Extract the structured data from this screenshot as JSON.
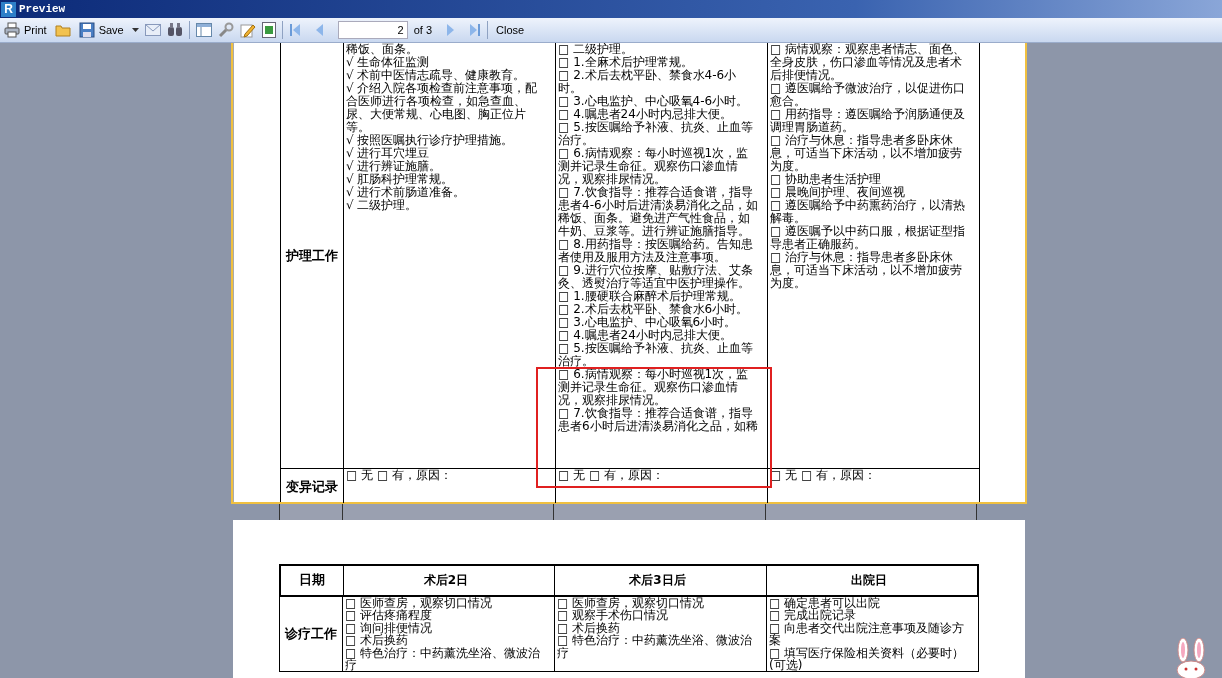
{
  "window": {
    "logo": "R",
    "title": "Preview"
  },
  "toolbar": {
    "print": "Print",
    "save": "Save",
    "page": "2",
    "of": "of 3",
    "close": "Close"
  },
  "pages": [
    {
      "selected": true,
      "highlight": true,
      "rows": [
        {
          "label": "护理工作",
          "cells": [
            [
              "稀饭、面条。",
              "√ 生命体征监测",
              "√ 术前中医情志疏导、健康教育。",
              "√ 介绍入院各项检查前注意事项，配合医师进行各项检查，如急查血、尿、大便常规、心电图、胸正位片等。",
              "√ 按照医嘱执行诊疗护理措施。",
              "√ 进行耳穴埋豆",
              "√ 进行辨证施膳。",
              "√ 肛肠科护理常规。",
              "√ 进行术前肠道准备。",
              "√ 二级护理。"
            ],
            [
              "□ 二级护理。",
              "□ 1.全麻术后护理常规。",
              "□ 2.术后去枕平卧、禁食水4-6小时。",
              "□ 3.心电监护、中心吸氧4-6小时。",
              "□ 4.嘱患者24小时内忌排大便。",
              "□ 5.按医嘱给予补液、抗炎、止血等治疗。",
              "□ 6.病情观察：每小时巡视1次，监测并记录生命征。观察伤口渗血情况，观察排尿情况。",
              "□ 7.饮食指导：推荐合适食谱，指导患者4-6小时后进清淡易消化之品，如稀饭、面条。避免进产气性食品，如牛奶、豆浆等。进行辨证施膳指导。",
              "□ 8.用药指导：按医嘱给药。告知患者使用及服用方法及注意事项。",
              "□ 9.进行穴位按摩、贴敷疗法、艾条灸、透熨治疗等适宜中医护理操作。",
              "□ 1.腰硬联合麻醉术后护理常规。",
              "□ 2.术后去枕平卧、禁食水6小时。",
              "□ 3.心电监护、中心吸氧6小时。",
              "□ 4.嘱患者24小时内忌排大便。",
              "□ 5.按医嘱给予补液、抗炎、止血等治疗。",
              "□ 6.病情观察：每小时巡视1次，监测并记录生命征。观察伤口渗血情况，观察排尿情况。",
              "□ 7.饮食指导：推荐合适食谱，指导患者6小时后进清淡易消化之品，如稀"
            ],
            [
              "□ 病情观察：观察患者情志、面色、全身皮肤，伤口渗血等情况及患者术后排便情况。",
              "□ 遵医嘱给予微波治疗，以促进伤口愈合。",
              "□ 用药指导：遵医嘱给予润肠通便及调理胃肠道药。",
              "□ 治疗与休息：指导患者多卧床休息，可适当下床活动，以不增加疲劳为度。",
              "□ 协助患者生活护理",
              "□ 晨晚间护理、夜间巡视",
              "□ 遵医嘱给予中药熏药治疗，以清热解毒。",
              "□ 遵医嘱予以中药口服，根据证型指导患者正确服药。",
              "□ 治疗与休息：指导患者多卧床休息，可适当下床活动，以不增加疲劳为度。"
            ]
          ]
        },
        {
          "label": "变异记录",
          "cells": [
            [
              "□ 无 □ 有，原因："
            ],
            [
              "□ 无 □ 有，原因："
            ],
            [
              "□ 无 □ 有，原因："
            ]
          ]
        }
      ]
    },
    {
      "selected": false,
      "header": [
        "日期",
        "术后2日",
        "术后3日后",
        "出院日"
      ],
      "rows": [
        {
          "label": "诊疗工作",
          "cells": [
            [
              "□ 医师查房，观察切口情况",
              "□ 评估疼痛程度",
              "□ 询问排便情况",
              "□ 术后换药",
              "□ 特色治疗：中药薰洗坐浴、微波治疗"
            ],
            [
              "□ 医师查房，观察切口情况",
              "□ 观察手术伤口情况",
              "□ 术后换药",
              "□ 特色治疗：中药薰洗坐浴、微波治疗"
            ],
            [
              "□ 确定患者可以出院",
              "□ 完成出院记录",
              "□ 向患者交代出院注意事项及随诊方案",
              "□ 填写医疗保险相关资料（必要时）(可选)"
            ]
          ]
        }
      ]
    }
  ]
}
